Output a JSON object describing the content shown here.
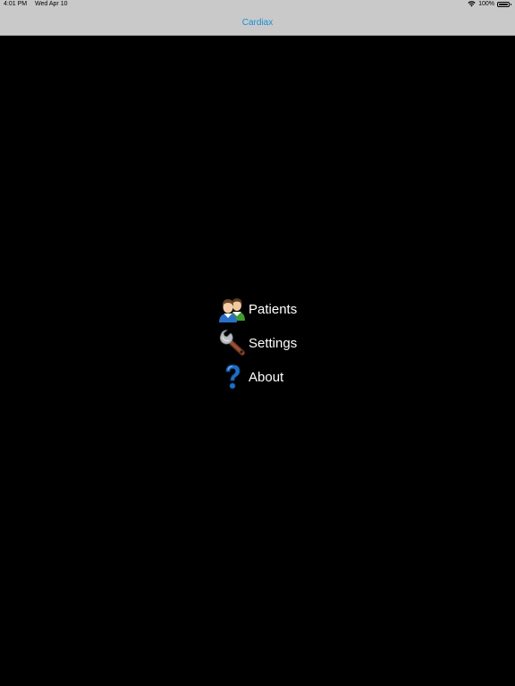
{
  "status_bar": {
    "time": "4:01 PM",
    "date": "Wed Apr 10",
    "battery": "100%"
  },
  "nav": {
    "title": "Cardiax"
  },
  "menu": {
    "items": [
      {
        "label": "Patients",
        "icon": "patients-icon"
      },
      {
        "label": "Settings",
        "icon": "wrench-icon"
      },
      {
        "label": "About",
        "icon": "question-icon"
      }
    ]
  },
  "colors": {
    "background": "#000000",
    "bar": "#c9c9c9",
    "accent": "#1b8fd6",
    "menu_text": "#ffffff"
  }
}
